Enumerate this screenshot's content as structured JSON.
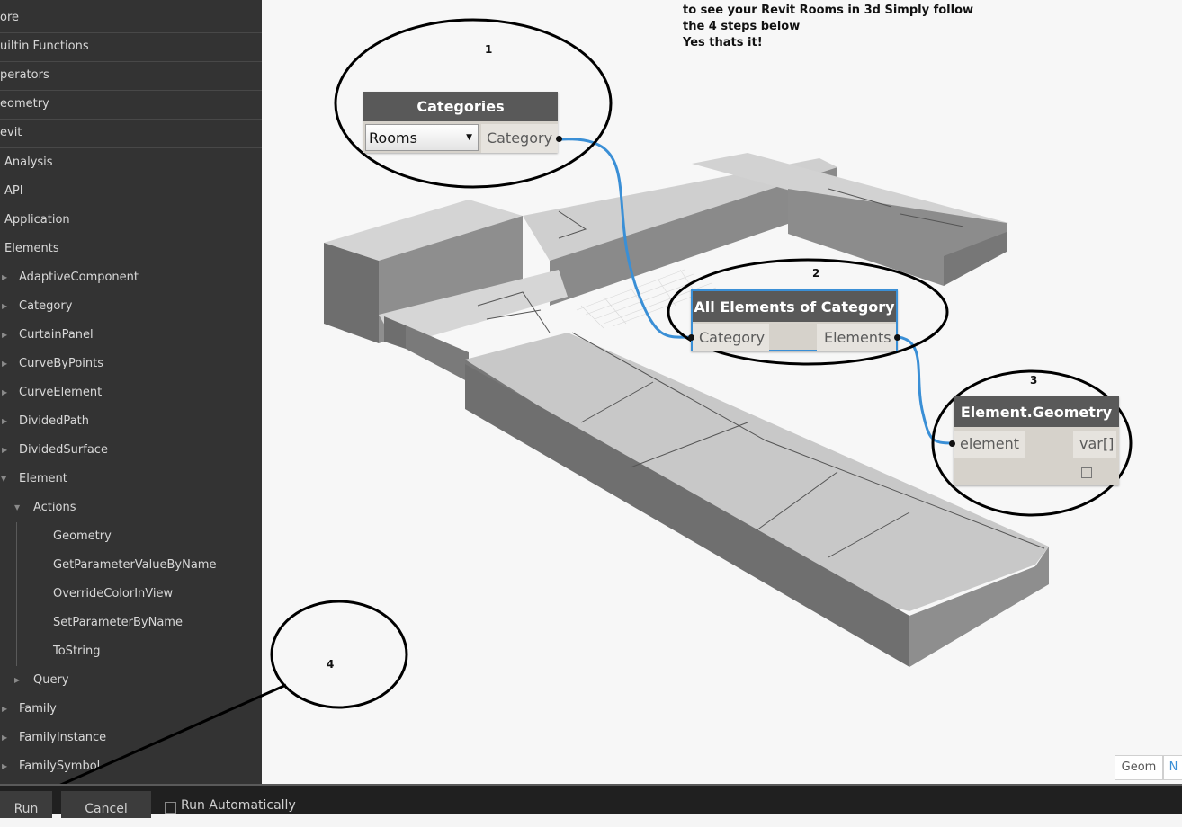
{
  "library": {
    "top_items": [
      "ore",
      "uiltin Functions",
      "perators",
      "eometry",
      "evit"
    ],
    "revit_children": [
      "Analysis",
      "API",
      "Application",
      "Elements"
    ],
    "elements_children": [
      "AdaptiveComponent",
      "Category",
      "CurtainPanel",
      "CurveByPoints",
      "CurveElement",
      "DividedPath",
      "DividedSurface",
      "Element"
    ],
    "element_children": [
      "Actions"
    ],
    "actions_children": [
      "Geometry",
      "GetParameterValueByName",
      "OverrideColorInView",
      "SetParameterByName",
      "ToString"
    ],
    "after_actions": [
      "Query"
    ],
    "elements_tail": [
      "Family",
      "FamilyInstance",
      "FamilySymbol"
    ]
  },
  "note": {
    "line1": "to see your Revit Rooms in 3d Simply follow",
    "line2": "the 4 steps below",
    "line3": "Yes thats it!"
  },
  "steps": [
    "1",
    "2",
    "3",
    "4"
  ],
  "nodes": {
    "categories": {
      "title": "Categories",
      "dropdown_value": "Rooms",
      "output": "Category"
    },
    "all_elements": {
      "title": "All Elements of Category",
      "input": "Category",
      "output": "Elements"
    },
    "element_geometry": {
      "title": "Element.Geometry",
      "input": "element",
      "output": "var[]"
    }
  },
  "view_toggle": {
    "geom": "Geom",
    "node": "N"
  },
  "bottom_bar": {
    "run": "Run",
    "cancel": "Cancel",
    "run_auto": "Run Automatically",
    "run_auto_checked": false
  },
  "colors": {
    "wire": "#3a8fd6",
    "node_header": "#595959",
    "node_body": "#d6d2cb",
    "selected_border": "#3a8fd6",
    "sidebar_bg": "#333333"
  }
}
